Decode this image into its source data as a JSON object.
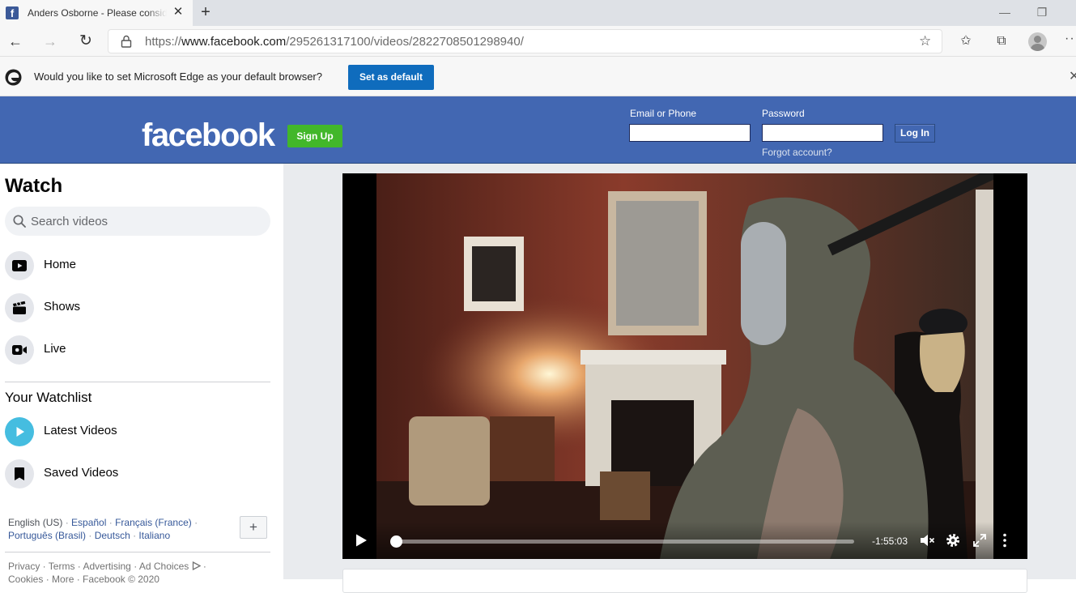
{
  "browser": {
    "tab_title": "Anders Osborne - Please consider",
    "tab_favicon": "f",
    "url_prefix": "https://",
    "url_host": "www.facebook.com",
    "url_path": "/295261317100/videos/2822708501298940/",
    "icons": {
      "back": "←",
      "forward": "→",
      "reload": "↻",
      "star": "☆",
      "favorites": "✩",
      "collections": "⧉",
      "more": "···",
      "close": "✕",
      "new_tab": "+",
      "minimize": "—",
      "maximize": "❐"
    }
  },
  "infobar": {
    "message": "Would you like to set Microsoft Edge as your default browser?",
    "button_label": "Set as default",
    "close_glyph": "✕"
  },
  "header": {
    "logo": "facebook",
    "signup_label": "Sign Up",
    "email_label": "Email or Phone",
    "password_label": "Password",
    "login_label": "Log In",
    "forgot_label": "Forgot account?",
    "brand_color": "#4267b2",
    "signup_color": "#42b72a"
  },
  "sidebar": {
    "title": "Watch",
    "search_placeholder": "Search videos",
    "nav": [
      {
        "label": "Home",
        "icon": "play-screen-icon"
      },
      {
        "label": "Shows",
        "icon": "clapperboard-icon"
      },
      {
        "label": "Live",
        "icon": "live-camera-icon"
      }
    ],
    "watchlist_title": "Your Watchlist",
    "watchlist": [
      {
        "label": "Latest Videos",
        "icon": "play-circle-icon"
      },
      {
        "label": "Saved Videos",
        "icon": "bookmark-icon"
      }
    ],
    "languages": {
      "current": "English (US)",
      "links": [
        "Español",
        "Français (France)",
        "Português (Brasil)",
        "Deutsch",
        "Italiano"
      ],
      "add_label": "+"
    },
    "footer": {
      "line1": [
        "Privacy",
        "Terms",
        "Advertising",
        "Ad Choices"
      ],
      "line2": [
        "Cookies",
        "More",
        "Facebook © 2020"
      ]
    }
  },
  "video": {
    "time_remaining": "-1:55:03",
    "progress": 0.0
  }
}
